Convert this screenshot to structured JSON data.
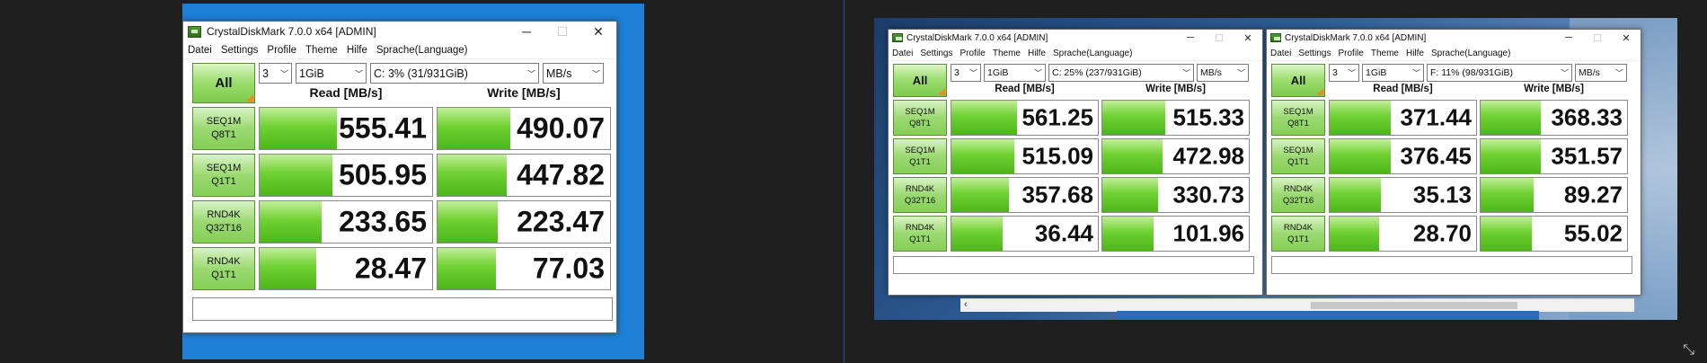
{
  "windows": [
    {
      "title": "CrystalDiskMark 7.0.0 x64 [ADMIN]",
      "menu": [
        "Datei",
        "Settings",
        "Profile",
        "Theme",
        "Hilfe",
        "Sprache(Language)"
      ],
      "all_label": "All",
      "count": "3",
      "size": "1GiB",
      "drive": "C: 3% (31/931GiB)",
      "unit": "MB/s",
      "read_header": "Read [MB/s]",
      "write_header": "Write [MB/s]",
      "rows": [
        {
          "l1": "SEQ1M",
          "l2": "Q8T1",
          "read": "555.41",
          "write": "490.07",
          "read_fill": 0.45,
          "write_fill": 0.42
        },
        {
          "l1": "SEQ1M",
          "l2": "Q1T1",
          "read": "505.95",
          "write": "447.82",
          "read_fill": 0.42,
          "write_fill": 0.4
        },
        {
          "l1": "RND4K",
          "l2": "Q32T16",
          "read": "233.65",
          "write": "223.47",
          "read_fill": 0.36,
          "write_fill": 0.35
        },
        {
          "l1": "RND4K",
          "l2": "Q1T1",
          "read": "28.47",
          "write": "77.03",
          "read_fill": 0.33,
          "write_fill": 0.34
        }
      ],
      "comment": ""
    },
    {
      "title": "CrystalDiskMark 7.0.0 x64 [ADMIN]",
      "menu": [
        "Datei",
        "Settings",
        "Profile",
        "Theme",
        "Hilfe",
        "Sprache(Language)"
      ],
      "all_label": "All",
      "count": "3",
      "size": "1GiB",
      "drive": "C: 25% (237/931GiB)",
      "unit": "MB/s",
      "read_header": "Read [MB/s]",
      "write_header": "Write [MB/s]",
      "rows": [
        {
          "l1": "SEQ1M",
          "l2": "Q8T1",
          "read": "561.25",
          "write": "515.33",
          "read_fill": 0.45,
          "write_fill": 0.43
        },
        {
          "l1": "SEQ1M",
          "l2": "Q1T1",
          "read": "515.09",
          "write": "472.98",
          "read_fill": 0.43,
          "write_fill": 0.41
        },
        {
          "l1": "RND4K",
          "l2": "Q32T16",
          "read": "357.68",
          "write": "330.73",
          "read_fill": 0.39,
          "write_fill": 0.38
        },
        {
          "l1": "RND4K",
          "l2": "Q1T1",
          "read": "36.44",
          "write": "101.96",
          "read_fill": 0.35,
          "write_fill": 0.35
        }
      ],
      "comment": ""
    },
    {
      "title": "CrystalDiskMark 7.0.0 x64 [ADMIN]",
      "menu": [
        "Datei",
        "Settings",
        "Profile",
        "Theme",
        "Hilfe",
        "Sprache(Language)"
      ],
      "all_label": "All",
      "count": "3",
      "size": "1GiB",
      "drive": "F: 11% (98/931GiB)",
      "unit": "MB/s",
      "read_header": "Read [MB/s]",
      "write_header": "Write [MB/s]",
      "rows": [
        {
          "l1": "SEQ1M",
          "l2": "Q8T1",
          "read": "371.44",
          "write": "368.33",
          "read_fill": 0.42,
          "write_fill": 0.41
        },
        {
          "l1": "SEQ1M",
          "l2": "Q1T1",
          "read": "376.45",
          "write": "351.57",
          "read_fill": 0.42,
          "write_fill": 0.41
        },
        {
          "l1": "RND4K",
          "l2": "Q32T16",
          "read": "35.13",
          "write": "89.27",
          "read_fill": 0.35,
          "write_fill": 0.36
        },
        {
          "l1": "RND4K",
          "l2": "Q1T1",
          "read": "28.70",
          "write": "55.02",
          "read_fill": 0.34,
          "write_fill": 0.35
        }
      ],
      "comment": ""
    }
  ],
  "window_buttons": {
    "minimize": "─",
    "maximize": "☐",
    "close": "✕"
  },
  "icons": {
    "app": "crystaldiskmark-icon",
    "scroll_left": "‹",
    "resize": "⤡"
  },
  "colors": {
    "bar_green": "#4db61a",
    "label_green": "#86cf57",
    "desktop_blue": "#1e7fd6",
    "divider": "#2f4f8a"
  }
}
